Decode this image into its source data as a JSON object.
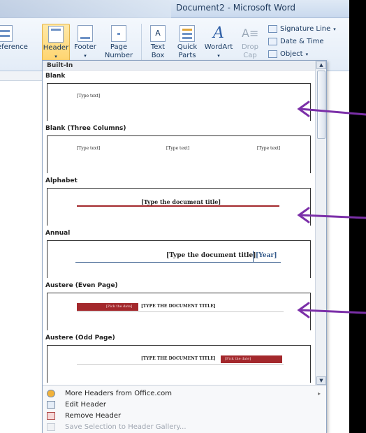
{
  "window": {
    "title": "Document2 - Microsoft Word"
  },
  "ribbon": {
    "reference_label": "eference",
    "header_label": "Header",
    "footer_label": "Footer",
    "page_number_label_1": "Page",
    "page_number_label_2": "Number",
    "text_box_label_1": "Text",
    "text_box_label_2": "Box",
    "quick_parts_label_1": "Quick",
    "quick_parts_label_2": "Parts",
    "wordart_label": "WordArt",
    "drop_cap_label_1": "Drop",
    "drop_cap_label_2": "Cap",
    "signature_line_label": "Signature Line",
    "date_time_label": "Date & Time",
    "object_label": "Object"
  },
  "gallery": {
    "category": "Built-In",
    "items": [
      {
        "title": "Blank",
        "texts": [
          "[Type text]"
        ]
      },
      {
        "title": "Blank (Three Columns)",
        "texts": [
          "[Type text]",
          "[Type text]",
          "[Type text]"
        ]
      },
      {
        "title": "Alphabet",
        "texts": [
          "[Type the document title]"
        ]
      },
      {
        "title": "Annual",
        "texts": [
          "[Type the document title]",
          "[Year]"
        ]
      },
      {
        "title": "Austere (Even Page)",
        "texts": [
          "[Pick the date]",
          "[TYPE THE DOCUMENT TITLE]"
        ]
      },
      {
        "title": "Austere (Odd Page)",
        "texts": [
          "[TYPE THE DOCUMENT TITLE]",
          "[Pick the date]"
        ]
      }
    ]
  },
  "menu": {
    "more_headers": "More Headers from Office.com",
    "edit_header": "Edit Header",
    "remove_header": "Remove Header",
    "save_selection": "Save Selection to Header Gallery..."
  },
  "colors": {
    "arrow": "#7b2fa8",
    "accent_red": "#a3282c",
    "annual_blue": "#345a8a"
  }
}
